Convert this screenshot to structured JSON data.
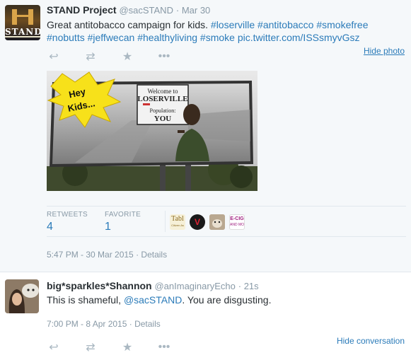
{
  "tweet": {
    "fullname": "STAND Project",
    "username": "@sacSTAND",
    "separator": " · ",
    "time": "Mar 30",
    "avatar_text": "STAND",
    "text_plain": "Great antitobacco campaign for kids. ",
    "hashtags_line1": [
      "#loserville",
      "#antitobacco",
      "#smokefree"
    ],
    "hashtags_line2": [
      "#nobutts",
      "#jeffwecan",
      "#healthyliving",
      "#smoke"
    ],
    "link": "pic.twitter.com/ISSsmyvGsz",
    "hide_photo": "Hide photo",
    "photo": {
      "bubble_line1": "Hey",
      "bubble_line2": "Kids...",
      "sign_line1": "Welcome to",
      "sign_line2": "LOSERVILLE",
      "sign_line3": "Population:",
      "sign_line4": "YOU"
    },
    "retweets_label": "RETWEETS",
    "retweets": "4",
    "favorites_label": "FAVORITE",
    "favorites": "1",
    "favoriters": [
      {
        "label": "Tabl",
        "sub": "Citizen As",
        "bg": "#f6f0d8",
        "color": "#8a6a1f"
      },
      {
        "label": "V",
        "bg": "#1a1a1a",
        "color": "#d23"
      },
      {
        "label": "",
        "bg": "#c9b8a0",
        "color": "#333"
      },
      {
        "label": "E-CIG",
        "sub": "AND MO",
        "bg": "#fff",
        "color": "#a02080"
      }
    ],
    "timestamp": "5:47 PM - 30 Mar 2015",
    "details": "Details",
    "details_sep": " · "
  },
  "reply": {
    "fullname": "big*sparkles*Shannon",
    "username": "@anImaginaryEcho",
    "separator": " · ",
    "time": "21s",
    "text_before": "This is shameful, ",
    "mention": "@sacSTAND",
    "text_after": ". You are disgusting.",
    "timestamp": "7:00 PM - 8 Apr 2015",
    "details": "Details",
    "details_sep": " · ",
    "hide_conversation": "Hide conversation"
  },
  "actions": {
    "reply_icon": "reply-icon",
    "retweet_icon": "retweet-icon",
    "favorite_icon": "star-icon",
    "more_icon": "more-icon"
  },
  "colors": {
    "link": "#2b7bb9",
    "muted": "#8899a6",
    "action_icon": "#aab8c2",
    "tweet_bg": "#f5f8fa"
  }
}
